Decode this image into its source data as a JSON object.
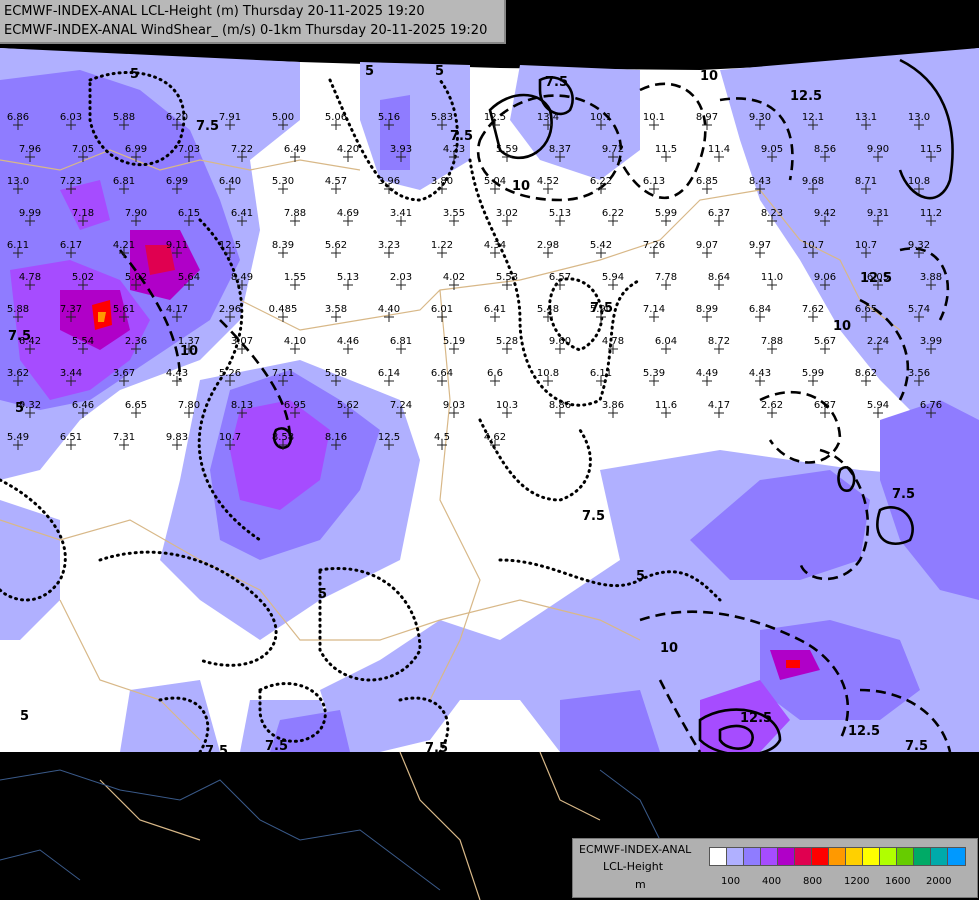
{
  "header": {
    "line1": "ECMWF-INDEX-ANAL LCL-Height (m) Thursday 20-11-2025 19:20",
    "line2": "ECMWF-INDEX-ANAL WindShear_ (m/s) 0-1km Thursday 20-11-2025 19:20"
  },
  "legend": {
    "title1": "ECMWF-INDEX-ANAL",
    "title2": "LCL-Height",
    "unit": "m",
    "colors": [
      "#ffffff",
      "#b0b0ff",
      "#8f7cff",
      "#a64cff",
      "#b000c8",
      "#e00050",
      "#ff0000",
      "#ff9900",
      "#ffd000",
      "#ffff00",
      "#b0ff00",
      "#66cc00",
      "#00aa66",
      "#00aaaa",
      "#0099ff"
    ],
    "ticks": [
      "100",
      "400",
      "800",
      "1200",
      "1600",
      "2000"
    ]
  },
  "contour_labels": [
    "5",
    "7.5",
    "10",
    "12.5"
  ],
  "values": [
    "6.86",
    "6.03",
    "5.88",
    "6.20",
    "7.91",
    "5.00",
    "5.06",
    "5.16",
    "5.83",
    "12.5",
    "13.4",
    "10.1",
    "10.1",
    "8.97",
    "9.30",
    "12.1",
    "13.1",
    "13.0",
    "7.96",
    "7.05",
    "6.99",
    "7.03",
    "7.22",
    "6.49",
    "4.20",
    "3.93",
    "4.23",
    "5.59",
    "8.37",
    "9.72",
    "11.5",
    "11.4",
    "9.05",
    "8.56",
    "9.90",
    "11.5",
    "13.0",
    "7.23",
    "6.81",
    "6.99",
    "6.40",
    "5.30",
    "4.57",
    "3.96",
    "3.80",
    "5.04",
    "4.52",
    "6.22",
    "6.13",
    "6.85",
    "8.43",
    "9.68",
    "8.71",
    "10.8",
    "9.99",
    "7.18",
    "7.90",
    "6.15",
    "6.41",
    "7.88",
    "4.69",
    "3.41",
    "3.55",
    "3.02",
    "5.13",
    "6.22",
    "5.99",
    "6.37",
    "8.23",
    "9.42",
    "9.31",
    "11.2",
    "6.11",
    "6.17",
    "4.21",
    "9.11",
    "12.5",
    "8.39",
    "5.62",
    "3.23",
    "1.22",
    "4.34",
    "2.98",
    "5.42",
    "7.26",
    "9.07",
    "9.97",
    "10.7",
    "10.7",
    "9.32",
    "4.78",
    "5.02",
    "5.02",
    "5.64",
    "8.49",
    "1.55",
    "5.13",
    "2.03",
    "4.02",
    "5.53",
    "6.57",
    "5.94",
    "7.78",
    "8.64",
    "11.0",
    "9.06",
    "6.05",
    "3.88",
    "5.88",
    "7.37",
    "5.61",
    "4.17",
    "2.96",
    "0.485",
    "3.58",
    "4.40",
    "6.01",
    "6.41",
    "5.48",
    "5.90",
    "7.14",
    "8.99",
    "6.84",
    "7.62",
    "6.65",
    "5.74",
    "6.42",
    "5.54",
    "2.36",
    "1.37",
    "3.07",
    "4.10",
    "4.46",
    "6.81",
    "5.19",
    "5.28",
    "9.60",
    "4.78",
    "6.04",
    "8.72",
    "7.88",
    "5.67",
    "2.24",
    "3.99",
    "3.62",
    "3.44",
    "3.67",
    "4.43",
    "5.26",
    "7.11",
    "5.58",
    "6.14",
    "6.64",
    "6.6",
    "10.8",
    "6.11",
    "5.39",
    "4.49",
    "4.43",
    "5.99",
    "8.62",
    "3.56",
    "9.32",
    "6.46",
    "6.65",
    "7.80",
    "8.13",
    "6.95",
    "5.62",
    "7.24",
    "9.03",
    "10.3",
    "8.86",
    "3.86",
    "11.6",
    "4.17",
    "2.62",
    "6.87",
    "5.94",
    "6.76",
    "5.49",
    "6.51",
    "7.31",
    "9.83",
    "10.7",
    "8.58",
    "8.16",
    "12.5",
    "4.5",
    "4.62"
  ]
}
